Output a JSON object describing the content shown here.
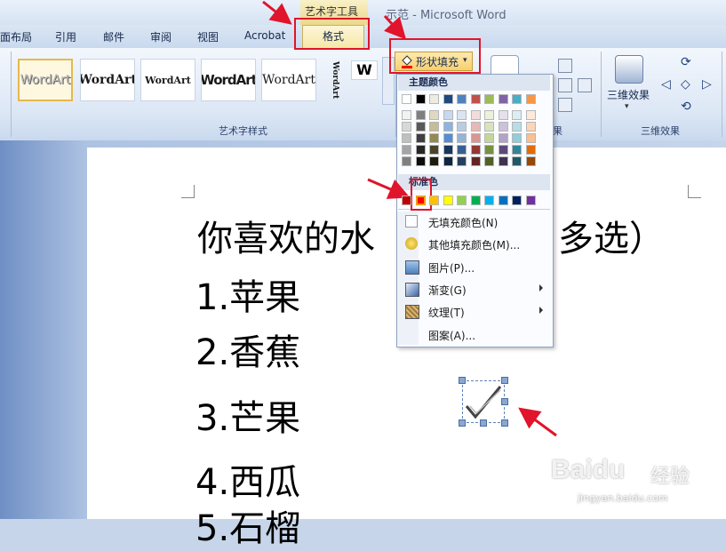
{
  "titlebar": {
    "context_group": "艺术字工具",
    "document_title": "示范 - Microsoft Word"
  },
  "tabs": {
    "page_layout": "面布局",
    "references": "引用",
    "mailings": "邮件",
    "review": "审阅",
    "view": "视图",
    "acrobat": "Acrobat",
    "format": "格式"
  },
  "ribbon": {
    "wordart_gallery": [
      "WordArt",
      "WordArt",
      "WordArt",
      "WordArt",
      "WordArt",
      "WordArt"
    ],
    "wordart_styles_label": "艺术字样式",
    "shape_fill_label": "形状填充",
    "effects_partial_label": "果",
    "three_d_button": "三维效果",
    "three_d_group_label": "三维效果"
  },
  "menu": {
    "theme_colors_label": "主题颜色",
    "standard_colors_label": "标准色",
    "items": [
      {
        "label": "无填充颜色(N)",
        "icon": "no-fill-icon",
        "submenu": false
      },
      {
        "label": "其他填充颜色(M)...",
        "icon": "color-palette-icon",
        "submenu": false
      },
      {
        "label": "图片(P)...",
        "icon": "picture-icon",
        "submenu": false
      },
      {
        "label": "渐变(G)",
        "icon": "gradient-icon",
        "submenu": true
      },
      {
        "label": "纹理(T)",
        "icon": "texture-icon",
        "submenu": true
      },
      {
        "label": "图案(A)...",
        "icon": "pattern-icon",
        "submenu": false
      }
    ],
    "theme_top_row": [
      "#ffffff",
      "#000000",
      "#eeece1",
      "#1f497d",
      "#4f81bd",
      "#c0504d",
      "#9bbb59",
      "#8064a2",
      "#4bacc6",
      "#f79646"
    ],
    "theme_shades": [
      [
        "#f2f2f2",
        "#7f7f7f",
        "#ddd9c3",
        "#c6d9f0",
        "#dbe5f1",
        "#f2dcdb",
        "#ebf1dd",
        "#e5e0ec",
        "#dbeef3",
        "#fdeada"
      ],
      [
        "#d8d8d8",
        "#595959",
        "#c4bd97",
        "#8db3e2",
        "#b8cce4",
        "#e5b9b7",
        "#d7e3bc",
        "#ccc1d9",
        "#b7dde8",
        "#fbd5b5"
      ],
      [
        "#bfbfbf",
        "#3f3f3f",
        "#938953",
        "#548dd4",
        "#95b3d7",
        "#d99694",
        "#c3d69b",
        "#b2a2c7",
        "#92cddc",
        "#fac08f"
      ],
      [
        "#a5a5a5",
        "#262626",
        "#494429",
        "#17365d",
        "#366092",
        "#953734",
        "#76923c",
        "#5f497a",
        "#31859b",
        "#e36c09"
      ],
      [
        "#7f7f7f",
        "#0c0c0c",
        "#1d1b10",
        "#0f243e",
        "#244061",
        "#632423",
        "#4f6128",
        "#3f3151",
        "#205867",
        "#974806"
      ]
    ],
    "standard_row": [
      "#c00000",
      "#ff0000",
      "#ffc000",
      "#ffff00",
      "#92d050",
      "#00b050",
      "#00b0f0",
      "#0070c0",
      "#002060",
      "#7030a0"
    ]
  },
  "document": {
    "lines": [
      "你喜欢的水",
      "多选）",
      "1.苹果",
      "2.香蕉",
      "3.芒果",
      "4.西瓜",
      "5.石榴"
    ]
  },
  "watermark": {
    "brand": "Baidu",
    "brand_cn": "经验",
    "url": "jingyan.baidu.com"
  },
  "colors": {
    "annotation_red": "#e0142b",
    "selected_color": "#ff0000"
  }
}
